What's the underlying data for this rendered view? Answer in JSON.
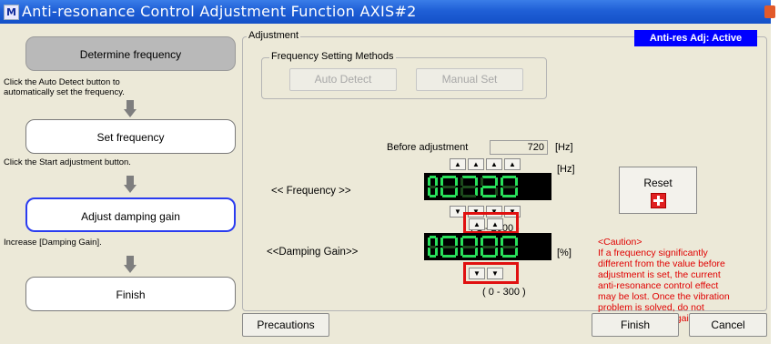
{
  "window": {
    "title": "Anti-resonance Control Adjustment Function AXIS#2",
    "icon_glyph": "M",
    "accent": "#1f5fd6"
  },
  "steps": [
    {
      "label": "Determine frequency",
      "state": "done",
      "desc": [
        "Click the Auto Detect button to",
        "automatically set the frequency."
      ]
    },
    {
      "label": "Set frequency",
      "state": "normal",
      "desc": [
        "Click the Start adjustment button."
      ]
    },
    {
      "label": "Adjust damping gain",
      "state": "active",
      "desc": [
        "Increase [Damping Gain]."
      ]
    },
    {
      "label": "Finish",
      "state": "normal",
      "desc": []
    }
  ],
  "adjustment": {
    "group_label": "Adjustment",
    "status_badge": "Anti-res Adj: Active",
    "freq_methods": {
      "label": "Frequency Setting Methods",
      "auto_detect": "Auto Detect",
      "manual_set": "Manual Set"
    },
    "before_adjustment": {
      "label": "Before adjustment",
      "value": "720",
      "unit": "[Hz]"
    },
    "frequency": {
      "label": "<< Frequency >>",
      "display": "00720",
      "unit": "[Hz]",
      "range": "( 1 - 2000 )",
      "up_arrows": [
        "▲",
        "▲",
        "▲",
        "▲"
      ],
      "down_arrows": [
        "▼",
        "▼",
        "▼",
        "▼"
      ]
    },
    "damping_gain": {
      "label": "<<Damping Gain>>",
      "display": "00000",
      "unit": "[%]",
      "range": "( 0 - 300 )",
      "up_arrows": [
        "▲",
        "▲"
      ],
      "down_arrows": [
        "▼",
        "▼"
      ]
    },
    "reset_label": "Reset",
    "caution": [
      "<Caution>",
      "If a frequency significantly",
      "different from the value before",
      "adjustment is set, the current",
      "anti-resonance control effect",
      "may be lost. Once the vibration",
      "problem is solved, do not",
      "increase damping gain."
    ]
  },
  "footer": {
    "precautions": "Precautions",
    "finish": "Finish",
    "cancel": "Cancel"
  },
  "colors": {
    "badge": "#0000ff",
    "caution": "#e00000",
    "highlight": "#e01010",
    "segment_on": "#28e05a",
    "active_step_border": "#2a3cf0"
  }
}
